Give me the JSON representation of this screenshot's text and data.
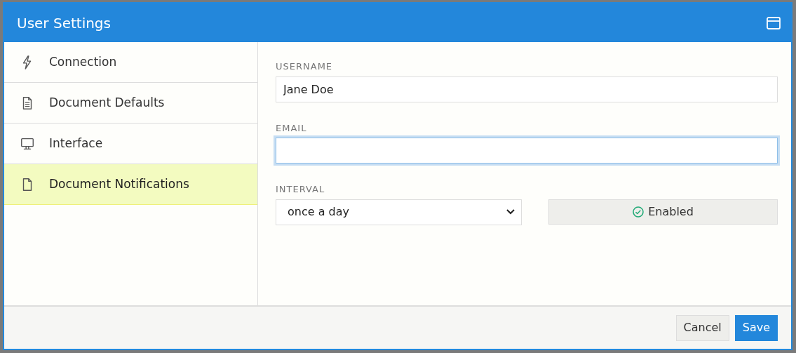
{
  "dialog": {
    "title": "User Settings"
  },
  "sidebar": {
    "items": [
      {
        "label": "Connection",
        "selected": false
      },
      {
        "label": "Document Defaults",
        "selected": false
      },
      {
        "label": "Interface",
        "selected": false
      },
      {
        "label": "Document Notifications",
        "selected": true
      }
    ]
  },
  "form": {
    "username": {
      "label": "USERNAME",
      "value": "Jane Doe",
      "focused": false
    },
    "email": {
      "label": "EMAIL",
      "focused": true
    },
    "interval": {
      "label": "INTERVAL",
      "value": "once a day"
    },
    "status": {
      "label": "Enabled",
      "enabled": true
    }
  },
  "footer": {
    "buttons": [
      {
        "label": "Cancel",
        "kind": "secondary"
      },
      {
        "label": "Save",
        "kind": "primary"
      }
    ]
  }
}
